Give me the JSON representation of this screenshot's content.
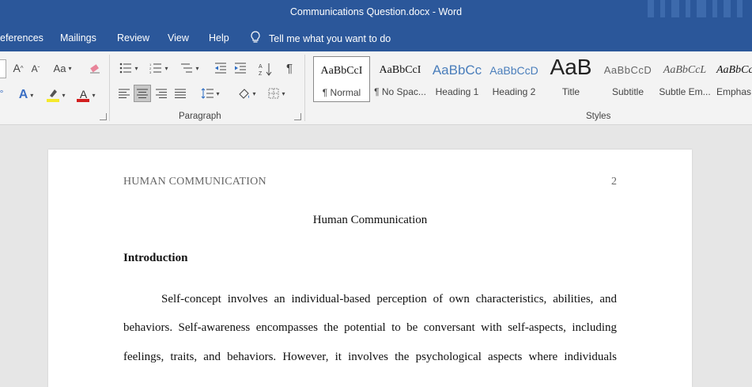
{
  "window": {
    "title": "Communications Question.docx  -  Word"
  },
  "tabs": [
    "eferences",
    "Mailings",
    "Review",
    "View",
    "Help"
  ],
  "tell_me": "Tell me what you want to do",
  "ribbon": {
    "groups": {
      "paragraph": "Paragraph",
      "styles": "Styles"
    },
    "font_buttons": {
      "change_case": "Aa",
      "grow": "A",
      "shrink": "A",
      "font_color": "A",
      "highlight_color": "#f5e92c",
      "font_color_hex": "#d21f1f"
    },
    "styles": [
      {
        "sample": "AaBbCcI",
        "name": "¶ Normal",
        "selected": true
      },
      {
        "sample": "AaBbCcI",
        "name": "¶ No Spac..."
      },
      {
        "sample": "AaBbCc",
        "name": "Heading 1"
      },
      {
        "sample": "AaBbCcD",
        "name": "Heading 2"
      },
      {
        "sample": "AaB",
        "name": "Title"
      },
      {
        "sample": "AaBbCcD",
        "name": "Subtitle"
      },
      {
        "sample": "AaBbCcL",
        "name": "Subtle Em..."
      },
      {
        "sample": "AaBbCc",
        "name": "Emphas"
      }
    ]
  },
  "document": {
    "running_head": "HUMAN COMMUNICATION",
    "page_number": "2",
    "title": "Human Communication",
    "heading": "Introduction",
    "paragraph_lines": [
      "Self-concept involves an individual-based perception of own characteristics, abilities, and",
      "behaviors. Self-awareness encompasses the potential to be conversant with self-aspects, including",
      "feelings, traits, and behaviors. However, it involves the psychological aspects where individuals"
    ]
  },
  "colors": {
    "word_blue": "#2b579a",
    "ribbon_bg": "#f3f3f3",
    "canvas_bg": "#e6e6e6"
  }
}
